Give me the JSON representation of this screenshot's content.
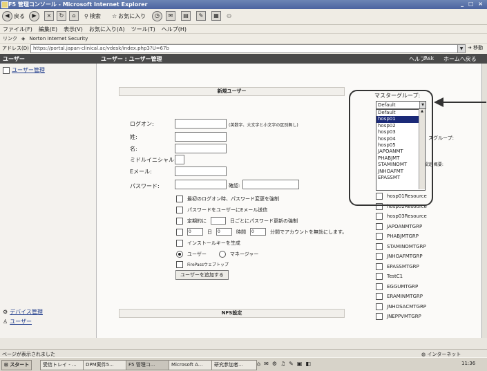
{
  "window": {
    "title": "F5 管理コンソール - Microsoft Internet Explorer",
    "controls": "_ □ ×"
  },
  "toolbar": {
    "back": "戻る",
    "search": "検索",
    "favorites": "お気に入り"
  },
  "menubar": [
    "ファイル(F)",
    "編集(E)",
    "表示(V)",
    "お気に入り(A)",
    "ツール(T)",
    "ヘルプ(H)"
  ],
  "linksbar": {
    "links": "リンク",
    "norton": "Norton Internet Security"
  },
  "address": {
    "label": "アドレス(D)",
    "url": "https://portal.japan-clinical.ac/vdesk/index.php3?U=67b",
    "go": "移動"
  },
  "app_header": {
    "left": "ユーザー",
    "center": "ユーザー : ユーザー管理",
    "help": "ヘルプ",
    "ask": "Ask",
    "home": "ホームへ戻る"
  },
  "sidebar": {
    "top_item": "ユーザー管理",
    "bottom_items": [
      "デバイス管理",
      "ユーザー"
    ]
  },
  "form": {
    "section_title": "新規ユーザー",
    "logon_label": "ログオン:",
    "logon_hint": "(英数字、大文字と小文字の区別無し)",
    "last_name_label": "姓:",
    "first_name_label": "名:",
    "middle_label": "ミドルイニシャル:",
    "email_label": "Eメール:",
    "password_label": "パスワード:",
    "confirm_label": "確認:",
    "opt1": "最初のログオン時、パスワード変更を強制",
    "opt2": "パスワードをユーザーにEメール送信",
    "opt3a": "定期的に",
    "opt3b": "日ごとにパスワード更新の強制",
    "opt4_day": "日",
    "opt4_hour": "時間",
    "opt4_tail": "分間でアカウントを無効にします。",
    "opt5": "インストールキーを生成",
    "radio_user": "ユーザー",
    "radio_manager": "マネージャー",
    "firepass": "FirePassウェブトップ",
    "add_button": "ユーザーを追加する",
    "opt4_zero1": "0",
    "opt4_zero2": "0",
    "opt4_zero3": "0",
    "section2_title": "NFS設定"
  },
  "groups": {
    "master_label": "マスターグループ:",
    "selected": "Default",
    "dropdown_options": [
      "Default",
      "hosp01",
      "hosp02",
      "hosp03",
      "hosp04",
      "hosp05",
      "JAPOANMT",
      "PHABJMT",
      "STAMINOMT",
      "JNHOAFMT",
      "EPASSMT"
    ],
    "highlighted_index": 1,
    "behind_text_1": "スグループ:",
    "behind_text_2": "設定 概要:",
    "resource_groups": [
      "hosp01Resource",
      "hosp02Resource",
      "hosp03Resource",
      "JAPOANMTGRP",
      "PHABJMTGRP",
      "STAMINOMTGRP",
      "JNHOAFMTGRP",
      "EPASSMTGRP",
      "TestC1",
      "EGGUMTGRP",
      "ERAMINMTGRP",
      "JNHOSACMTGRP",
      "JNEPPVMTGRP"
    ]
  },
  "statusbar": {
    "left": "ページが表示されました",
    "zone": "インターネット"
  },
  "taskbar": {
    "start": "スタート",
    "tasks": [
      "受信トレイ - ...",
      "DPM案件5...",
      "F5 管理コ...",
      "Microsoft A...",
      "研究参加者..."
    ],
    "clock": "11:36"
  },
  "colors": {
    "title_bar": "#4b63a0",
    "app_header": "#4a4a4a",
    "highlight": "#1b2a78",
    "annotation_outline": "#333333"
  }
}
